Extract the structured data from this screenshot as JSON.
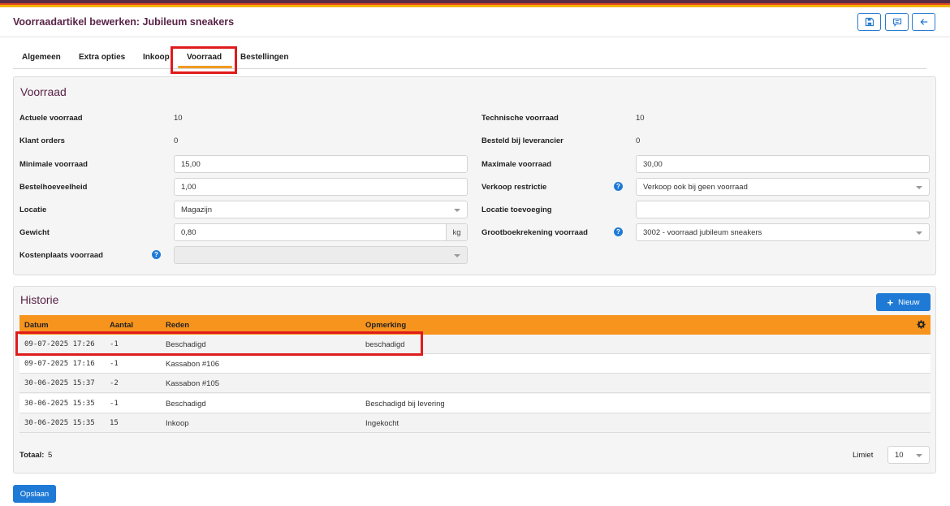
{
  "header": {
    "title": "Voorraadartikel bewerken: Jubileum sneakers",
    "buttons": [
      {
        "icon": "save-icon"
      },
      {
        "icon": "comment-icon"
      },
      {
        "icon": "arrow-left-icon"
      }
    ]
  },
  "tabs": [
    {
      "label": "Algemeen"
    },
    {
      "label": "Extra opties"
    },
    {
      "label": "Inkoop"
    },
    {
      "label": "Voorraad",
      "active": true
    },
    {
      "label": "Bestellingen"
    }
  ],
  "voorraad": {
    "title": "Voorraad",
    "actuele_label": "Actuele voorraad",
    "actuele_value": "10",
    "klant_label": "Klant orders",
    "klant_value": "0",
    "minimale_label": "Minimale voorraad",
    "minimale_value": "15,00",
    "bestelhoev_label": "Bestelhoeveelheid",
    "bestelhoev_value": "1,00",
    "locatie_label": "Locatie",
    "locatie_value": "Magazijn",
    "gewicht_label": "Gewicht",
    "gewicht_value": "0,80",
    "gewicht_unit": "kg",
    "kostenplaats_label": "Kostenplaats voorraad",
    "kostenplaats_value": "",
    "technische_label": "Technische voorraad",
    "technische_value": "10",
    "besteld_label": "Besteld bij leverancier",
    "besteld_value": "0",
    "maximale_label": "Maximale voorraad",
    "maximale_value": "30,00",
    "verkoop_label": "Verkoop restrictie",
    "verkoop_value": "Verkoop ook bij geen voorraad",
    "loctoev_label": "Locatie toevoeging",
    "loctoev_value": "",
    "grootboek_label": "Grootboekrekening voorraad",
    "grootboek_value": "3002 - voorraad jubileum sneakers",
    "help_glyph": "?"
  },
  "historie": {
    "title": "Historie",
    "new_label": "Nieuw",
    "columns": [
      "Datum",
      "Aantal",
      "Reden",
      "Opmerking"
    ],
    "rows": [
      [
        "09-07-2025 17:26",
        "-1",
        "Beschadigd",
        "beschadigd"
      ],
      [
        "09-07-2025 17:16",
        "-1",
        "Kassabon #106",
        ""
      ],
      [
        "30-06-2025 15:37",
        "-2",
        "Kassabon #105",
        ""
      ],
      [
        "30-06-2025 15:35",
        "-1",
        "Beschadigd",
        "Beschadigd bij levering"
      ],
      [
        "30-06-2025 15:35",
        "15",
        "Inkoop",
        "Ingekocht"
      ]
    ],
    "totaal_label": "Totaal:",
    "totaal_value": "5",
    "limiet_label": "Limiet",
    "limiet_value": "10"
  },
  "save_label": "Opslaan",
  "colors": {
    "accent_blue": "#1f7ad6",
    "table_header": "#f7941d",
    "title_purple": "#5a2348",
    "highlight_red": "#e01b1b"
  }
}
